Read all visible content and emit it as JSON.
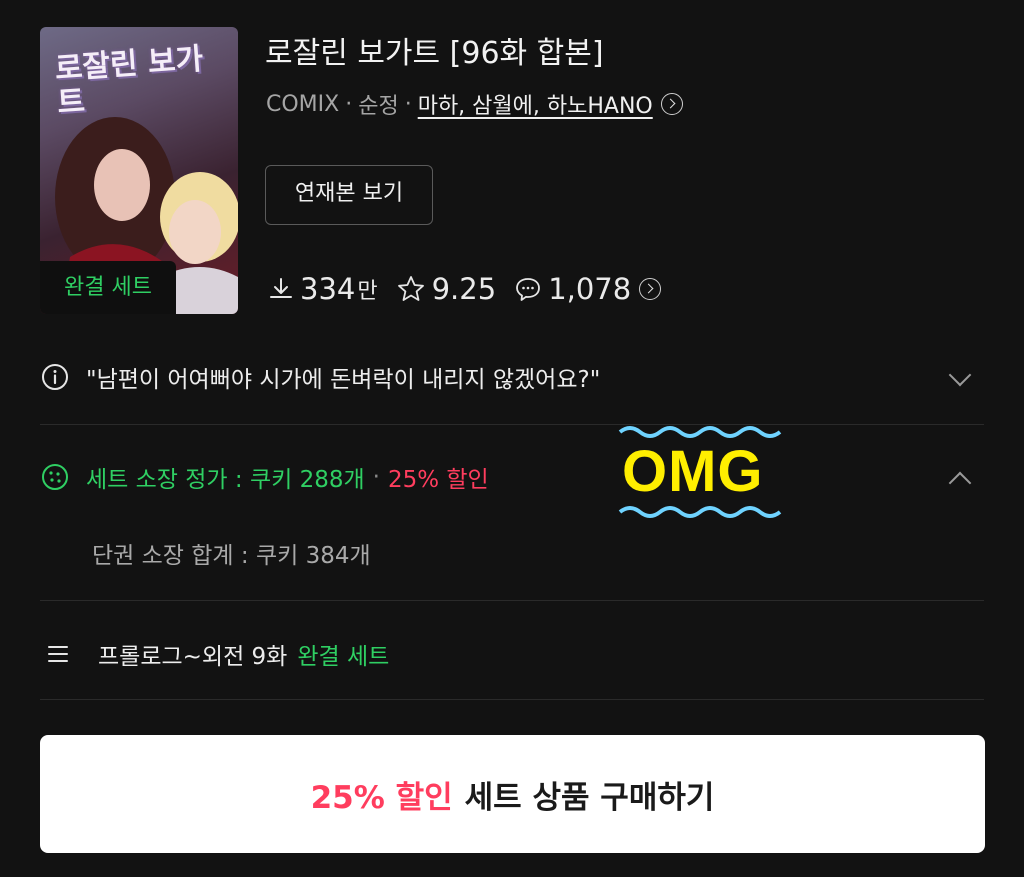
{
  "cover": {
    "title": "로잘린 보가트",
    "badge": "완결 세트"
  },
  "header": {
    "title": "로잘린 보가트 [96화 합본]",
    "publisher": "COMIX",
    "genre": "순정",
    "authors": "마하, 삼월에, 하노HANO",
    "serial_button": "연재본 보기"
  },
  "stats": {
    "downloads": "334",
    "downloads_unit": "만",
    "rating": "9.25",
    "comments": "1,078"
  },
  "synopsis": "\"남편이 어여뻐야 시가에 돈벼락이 내리지 않겠어요?\"",
  "pricing": {
    "set_price": "세트 소장 정가 : 쿠키 288개",
    "discount": "25% 할인",
    "single_total": "단권 소장 합계 : 쿠키 384개"
  },
  "annotation": "OMG",
  "contents": {
    "range": "프롤로그~외전 9화",
    "label": "완결 세트"
  },
  "buy": {
    "discount": "25% 할인",
    "label": "세트 상품 구매하기"
  },
  "colors": {
    "accent_green": "#2fcf63",
    "accent_red": "#ff3d5e",
    "annotation_yellow": "#ffee00",
    "annotation_wave": "#6fd3ff"
  }
}
